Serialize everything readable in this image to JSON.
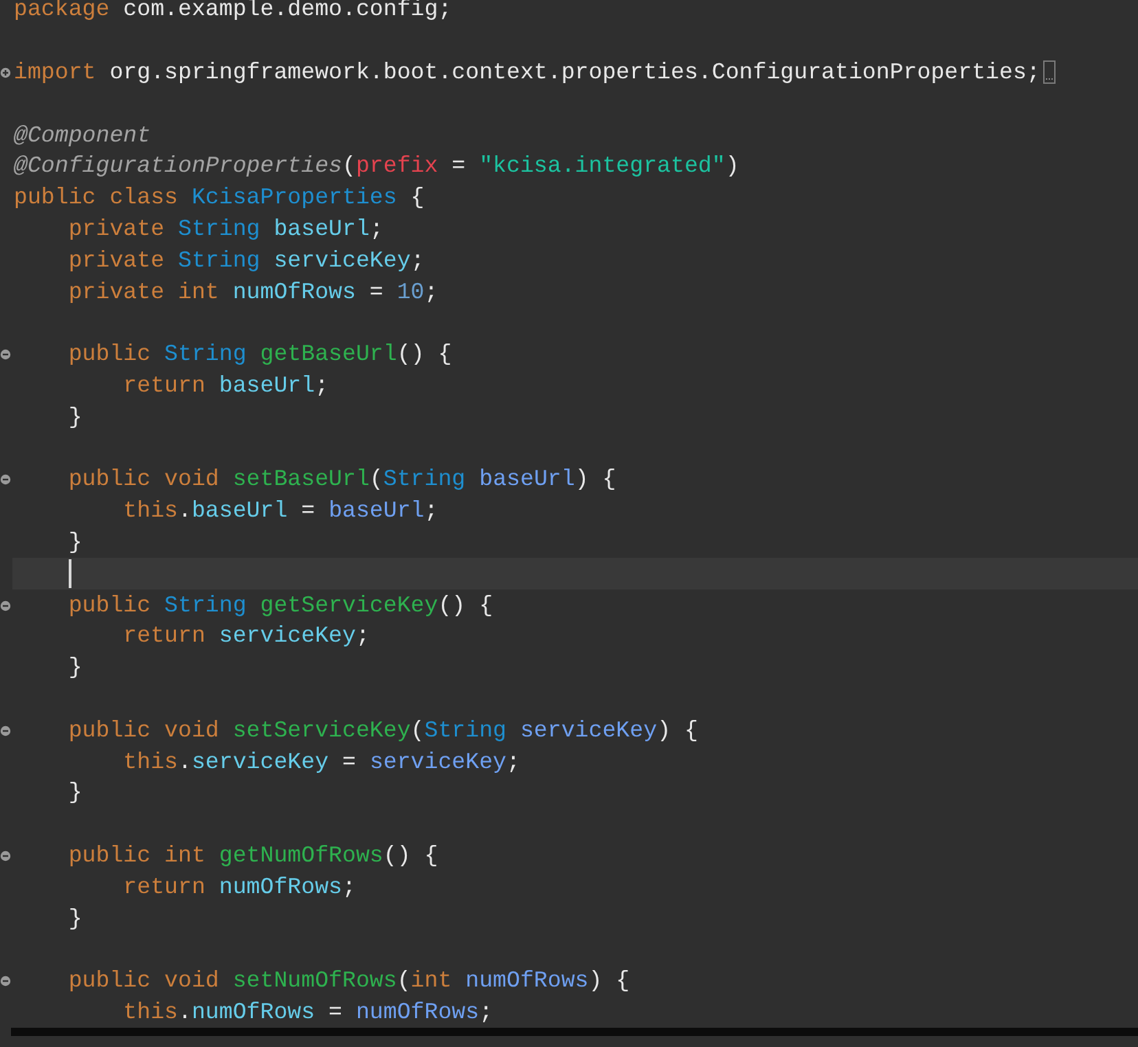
{
  "editor": {
    "lines": [
      {
        "kind": "code",
        "tokens": [
          {
            "kind": "keyword",
            "text": "package"
          },
          {
            "kind": "plain",
            "text": " com.example.demo.config;"
          }
        ]
      },
      {
        "kind": "blank"
      },
      {
        "kind": "code",
        "collapsed": true,
        "tokens": [
          {
            "kind": "keyword",
            "text": "import "
          },
          {
            "kind": "plain",
            "text": "org.springframework.boot.context.properties.ConfigurationProperties;"
          }
        ]
      },
      {
        "kind": "blank"
      },
      {
        "kind": "code",
        "tokens": [
          {
            "kind": "annotation",
            "text": "@Component"
          }
        ]
      },
      {
        "kind": "code",
        "tokens": [
          {
            "kind": "annotation",
            "text": "@ConfigurationProperties"
          },
          {
            "kind": "plain",
            "text": "("
          },
          {
            "kind": "attribute",
            "text": "prefix"
          },
          {
            "kind": "plain",
            "text": " = "
          },
          {
            "kind": "string",
            "text": "\"kcisa.integrated\""
          },
          {
            "kind": "plain",
            "text": ")"
          }
        ]
      },
      {
        "kind": "code",
        "tokens": [
          {
            "kind": "keyword",
            "text": "public class "
          },
          {
            "kind": "type",
            "text": "KcisaProperties"
          },
          {
            "kind": "plain",
            "text": " {"
          }
        ]
      },
      {
        "kind": "code",
        "tokens": [
          {
            "kind": "keyword",
            "text": "    private "
          },
          {
            "kind": "type",
            "text": "String "
          },
          {
            "kind": "field",
            "text": "baseUrl"
          },
          {
            "kind": "plain",
            "text": ";"
          }
        ]
      },
      {
        "kind": "code",
        "tokens": [
          {
            "kind": "keyword",
            "text": "    private "
          },
          {
            "kind": "type",
            "text": "String "
          },
          {
            "kind": "field",
            "text": "serviceKey"
          },
          {
            "kind": "plain",
            "text": ";"
          }
        ]
      },
      {
        "kind": "code",
        "tokens": [
          {
            "kind": "keyword",
            "text": "    private int "
          },
          {
            "kind": "field",
            "text": "numOfRows"
          },
          {
            "kind": "plain",
            "text": " = "
          },
          {
            "kind": "number",
            "text": "10"
          },
          {
            "kind": "plain",
            "text": ";"
          }
        ]
      },
      {
        "kind": "blank"
      },
      {
        "kind": "code",
        "collapsed": false,
        "tokens": [
          {
            "kind": "keyword",
            "text": "    public "
          },
          {
            "kind": "type",
            "text": "String "
          },
          {
            "kind": "method",
            "text": "getBaseUrl"
          },
          {
            "kind": "plain",
            "text": "() {"
          }
        ]
      },
      {
        "kind": "code",
        "tokens": [
          {
            "kind": "keyword",
            "text": "        return "
          },
          {
            "kind": "field",
            "text": "baseUrl"
          },
          {
            "kind": "plain",
            "text": ";"
          }
        ]
      },
      {
        "kind": "code",
        "tokens": [
          {
            "kind": "plain",
            "text": "    }"
          }
        ]
      },
      {
        "kind": "blank"
      },
      {
        "kind": "code",
        "collapsed": false,
        "tokens": [
          {
            "kind": "keyword",
            "text": "    public void "
          },
          {
            "kind": "method",
            "text": "setBaseUrl"
          },
          {
            "kind": "plain",
            "text": "("
          },
          {
            "kind": "type",
            "text": "String "
          },
          {
            "kind": "param",
            "text": "baseUrl"
          },
          {
            "kind": "plain",
            "text": ") {"
          }
        ]
      },
      {
        "kind": "code",
        "tokens": [
          {
            "kind": "keyword",
            "text": "        this"
          },
          {
            "kind": "plain",
            "text": "."
          },
          {
            "kind": "field",
            "text": "baseUrl"
          },
          {
            "kind": "plain",
            "text": " = "
          },
          {
            "kind": "param",
            "text": "baseUrl"
          },
          {
            "kind": "plain",
            "text": ";"
          }
        ]
      },
      {
        "kind": "code",
        "tokens": [
          {
            "kind": "plain",
            "text": "    }"
          }
        ]
      },
      {
        "kind": "cursor",
        "current": true
      },
      {
        "kind": "code",
        "collapsed": false,
        "tokens": [
          {
            "kind": "keyword",
            "text": "    public "
          },
          {
            "kind": "type",
            "text": "String "
          },
          {
            "kind": "method",
            "text": "getServiceKey"
          },
          {
            "kind": "plain",
            "text": "() {"
          }
        ]
      },
      {
        "kind": "code",
        "tokens": [
          {
            "kind": "keyword",
            "text": "        return "
          },
          {
            "kind": "field",
            "text": "serviceKey"
          },
          {
            "kind": "plain",
            "text": ";"
          }
        ]
      },
      {
        "kind": "code",
        "tokens": [
          {
            "kind": "plain",
            "text": "    }"
          }
        ]
      },
      {
        "kind": "blank"
      },
      {
        "kind": "code",
        "collapsed": false,
        "tokens": [
          {
            "kind": "keyword",
            "text": "    public void "
          },
          {
            "kind": "method",
            "text": "setServiceKey"
          },
          {
            "kind": "plain",
            "text": "("
          },
          {
            "kind": "type",
            "text": "String "
          },
          {
            "kind": "param",
            "text": "serviceKey"
          },
          {
            "kind": "plain",
            "text": ") {"
          }
        ]
      },
      {
        "kind": "code",
        "tokens": [
          {
            "kind": "keyword",
            "text": "        this"
          },
          {
            "kind": "plain",
            "text": "."
          },
          {
            "kind": "field",
            "text": "serviceKey"
          },
          {
            "kind": "plain",
            "text": " = "
          },
          {
            "kind": "param",
            "text": "serviceKey"
          },
          {
            "kind": "plain",
            "text": ";"
          }
        ]
      },
      {
        "kind": "code",
        "tokens": [
          {
            "kind": "plain",
            "text": "    }"
          }
        ]
      },
      {
        "kind": "blank"
      },
      {
        "kind": "code",
        "collapsed": false,
        "tokens": [
          {
            "kind": "keyword",
            "text": "    public int "
          },
          {
            "kind": "method",
            "text": "getNumOfRows"
          },
          {
            "kind": "plain",
            "text": "() {"
          }
        ]
      },
      {
        "kind": "code",
        "tokens": [
          {
            "kind": "keyword",
            "text": "        return "
          },
          {
            "kind": "field",
            "text": "numOfRows"
          },
          {
            "kind": "plain",
            "text": ";"
          }
        ]
      },
      {
        "kind": "code",
        "tokens": [
          {
            "kind": "plain",
            "text": "    }"
          }
        ]
      },
      {
        "kind": "blank"
      },
      {
        "kind": "code",
        "collapsed": false,
        "tokens": [
          {
            "kind": "keyword",
            "text": "    public void "
          },
          {
            "kind": "method",
            "text": "setNumOfRows"
          },
          {
            "kind": "plain",
            "text": "("
          },
          {
            "kind": "keyword",
            "text": "int "
          },
          {
            "kind": "param",
            "text": "numOfRows"
          },
          {
            "kind": "plain",
            "text": ") {"
          }
        ]
      },
      {
        "kind": "code",
        "tokens": [
          {
            "kind": "keyword",
            "text": "        this"
          },
          {
            "kind": "plain",
            "text": "."
          },
          {
            "kind": "field",
            "text": "numOfRows"
          },
          {
            "kind": "plain",
            "text": " = "
          },
          {
            "kind": "param",
            "text": "numOfRows"
          },
          {
            "kind": "plain",
            "text": ";"
          }
        ]
      }
    ]
  }
}
